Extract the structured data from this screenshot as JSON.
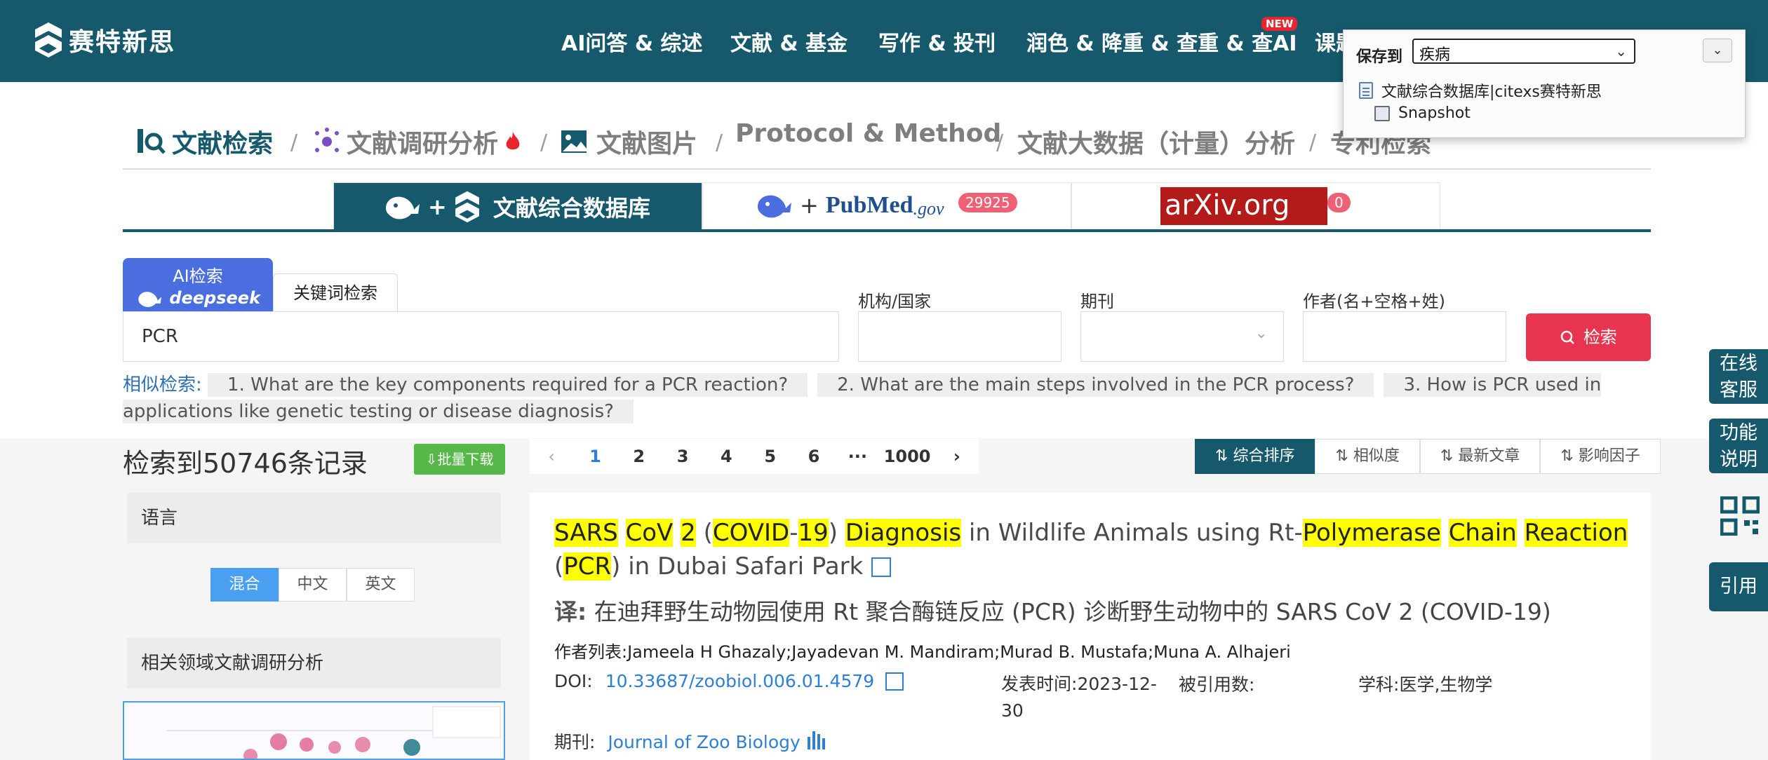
{
  "brand": {
    "name": "赛特新思"
  },
  "nav": {
    "items": [
      "AI问答 & 综述",
      "文献 & 基金",
      "写作 & 投刊",
      "润色 & 降重 & 查重 & 查AI",
      "课题"
    ],
    "new_badge": "NEW"
  },
  "save_popup": {
    "label": "保存到",
    "selected": "疾病",
    "items": [
      "文献综合数据库|citexs赛特新思",
      "Snapshot"
    ]
  },
  "categories": [
    "文献检索",
    "文献调研分析",
    "文献图片",
    "Protocol & Method",
    "文献大数据（计量）分析",
    "专利检索"
  ],
  "db_tabs": {
    "tab1_label": "文献综合数据库",
    "pubmed_label": "PubMed",
    "pubmed_suffix": ".gov",
    "pubmed_count": "29925",
    "arxiv_label": "arXiv.org",
    "arxiv_count": "0"
  },
  "search": {
    "ai_tab_line1": "AI检索",
    "ai_tab_line2": "deepseek",
    "kw_tab": "关键词检索",
    "query": "PCR",
    "org_label": "机构/国家",
    "journal_label": "期刊",
    "author_label": "作者(名+空格+姓)",
    "button": "检索"
  },
  "similar": {
    "lead": "相似检索",
    "items": [
      "1. What are the key components required for a PCR reaction?",
      "2. What are the main steps involved in the PCR process?",
      "3. How is PCR used in applications like genetic testing or disease diagnosis?"
    ]
  },
  "results": {
    "count_text": "检索到50746条记录",
    "bulk_download": "批量下载",
    "pages": [
      "1",
      "2",
      "3",
      "4",
      "5",
      "6",
      "···",
      "1000"
    ],
    "current_page": "1",
    "sort": [
      "综合排序",
      "相似度",
      "最新文章",
      "影响因子"
    ]
  },
  "sidebar": {
    "language_title": "语言",
    "lang_options": [
      "混合",
      "中文",
      "英文"
    ],
    "related_title": "相关领域文献调研分析"
  },
  "result_item": {
    "title_tokens": [
      {
        "t": "SARS",
        "h": true
      },
      {
        "t": " ",
        "h": false
      },
      {
        "t": "CoV",
        "h": true
      },
      {
        "t": " ",
        "h": false
      },
      {
        "t": "2",
        "h": true
      },
      {
        "t": " (",
        "h": false
      },
      {
        "t": "COVID",
        "h": true
      },
      {
        "t": "-",
        "h": false
      },
      {
        "t": "19",
        "h": true
      },
      {
        "t": ") ",
        "h": false
      },
      {
        "t": "Diagnosis",
        "h": true
      },
      {
        "t": " in Wildlife Animals using Rt-",
        "h": false
      },
      {
        "t": "Polymerase",
        "h": true
      },
      {
        "t": " ",
        "h": false
      },
      {
        "t": "Chain",
        "h": true
      },
      {
        "t": " ",
        "h": false
      },
      {
        "t": "Reaction",
        "h": true
      },
      {
        "t": " (",
        "h": false
      },
      {
        "t": "PCR",
        "h": true
      },
      {
        "t": ") in Dubai Safari Park",
        "h": false
      }
    ],
    "translation_label": "译:",
    "translation": "在迪拜野生动物园使用 Rt 聚合酶链反应 (PCR) 诊断野生动物中的 SARS CoV 2 (COVID-19)",
    "authors_label": "作者列表:",
    "authors": "Jameela H Ghazaly;Jayadevan M. Mandiram;Murad B. Mustafa;Muna A. Alhajeri",
    "doi_label": "DOI:",
    "doi": "10.33687/zoobiol.006.01.4579",
    "pub_label": "发表时间:",
    "pub_line1": "2023-12-",
    "pub_line2": "30",
    "cited_label": "被引用数:",
    "subject_label": "学科:",
    "subject": "医学,生物学",
    "journal_label": "期刊:",
    "journal": "Journal of Zoo Biology"
  },
  "floating": {
    "service_line1": "在线",
    "service_line2": "客服",
    "help_line1": "功能",
    "help_line2": "说明",
    "cite": "引用"
  },
  "colors": {
    "brand_teal": "#16596d",
    "search_red": "#e8354f",
    "highlight": "#ffff00",
    "ai_blue": "#4a6ee0",
    "download_green": "#56b848"
  }
}
